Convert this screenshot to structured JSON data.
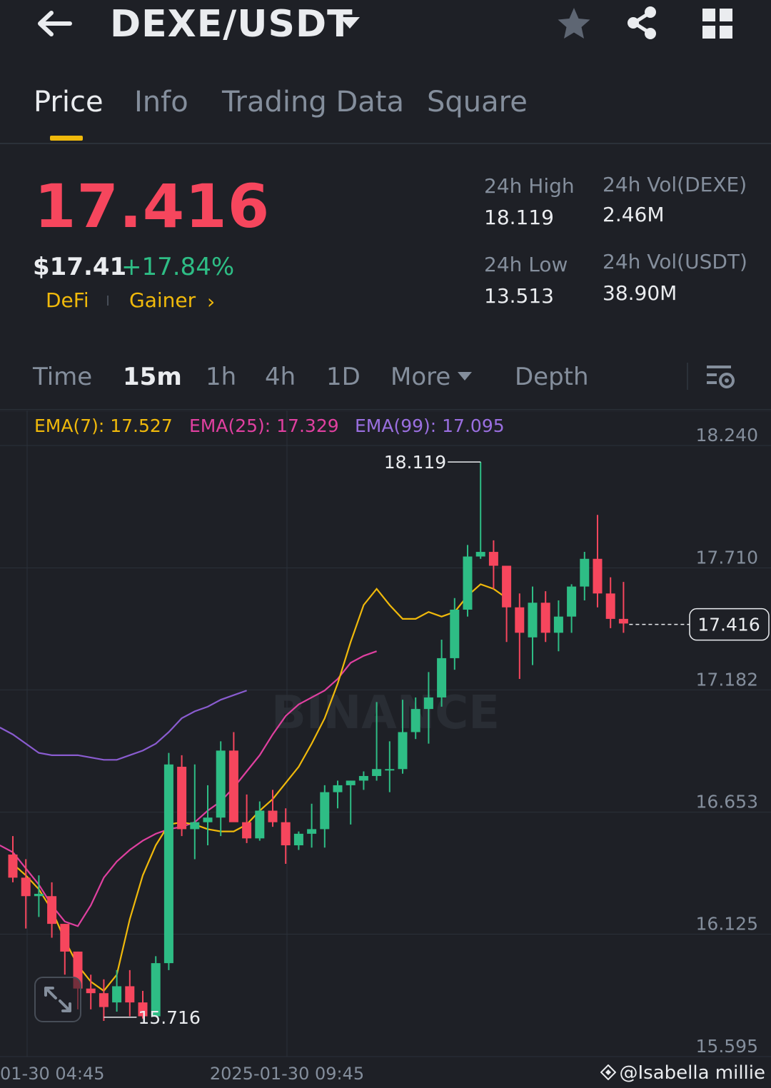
{
  "header": {
    "pair": "DEXE/USDT"
  },
  "tabs": [
    {
      "label": "Price",
      "active": true
    },
    {
      "label": "Info",
      "active": false
    },
    {
      "label": "Trading Data",
      "active": false
    },
    {
      "label": "Square",
      "active": false
    }
  ],
  "ticker": {
    "last_price": "17.416",
    "usd_price": "$17.41",
    "change_pct": "+17.84%",
    "tags": [
      "DeFi",
      "Gainer"
    ],
    "high_24h_label": "24h High",
    "high_24h": "18.119",
    "low_24h_label": "24h Low",
    "low_24h": "13.513",
    "vol_base_label": "24h Vol(DEXE)",
    "vol_base": "2.46M",
    "vol_quote_label": "24h Vol(USDT)",
    "vol_quote": "38.90M"
  },
  "intervals": {
    "items": [
      "Time",
      "15m",
      "1h",
      "4h",
      "1D",
      "More",
      "Depth"
    ],
    "active": "15m"
  },
  "indicators": {
    "ema7": "EMA(7): 17.527",
    "ema25": "EMA(25): 17.329",
    "ema99": "EMA(99): 17.095"
  },
  "colors": {
    "up": "#2ebd85",
    "down": "#f6465d",
    "accent": "#f0b90b",
    "ema7": "#f0b90b",
    "ema25": "#e040a0",
    "ema99": "#8a5cd0"
  },
  "chart_data": {
    "type": "candlestick",
    "y_ticks": [
      "18.240",
      "17.710",
      "17.182",
      "16.653",
      "16.125",
      "15.595"
    ],
    "x_ticks": [
      "01-30 04:45",
      "2025-01-30 09:45"
    ],
    "current_price_label": "17.416",
    "high_marker": "18.119",
    "low_marker": "15.716",
    "ylim": [
      15.595,
      18.24
    ],
    "candles": [
      {
        "o": 16.42,
        "h": 16.5,
        "l": 16.3,
        "c": 16.32
      },
      {
        "o": 16.32,
        "h": 16.4,
        "l": 16.1,
        "c": 16.24
      },
      {
        "o": 16.24,
        "h": 16.33,
        "l": 16.15,
        "c": 16.25
      },
      {
        "o": 16.24,
        "h": 16.3,
        "l": 16.06,
        "c": 16.12
      },
      {
        "o": 16.12,
        "h": 16.12,
        "l": 15.9,
        "c": 16.0
      },
      {
        "o": 16.0,
        "h": 16.0,
        "l": 15.75,
        "c": 15.84
      },
      {
        "o": 15.84,
        "h": 15.9,
        "l": 15.75,
        "c": 15.82
      },
      {
        "o": 15.82,
        "h": 15.88,
        "l": 15.7,
        "c": 15.76
      },
      {
        "o": 15.78,
        "h": 15.92,
        "l": 15.74,
        "c": 15.85
      },
      {
        "o": 15.85,
        "h": 15.92,
        "l": 15.72,
        "c": 15.78
      },
      {
        "o": 15.78,
        "h": 15.83,
        "l": 15.71,
        "c": 15.72
      },
      {
        "o": 15.72,
        "h": 15.98,
        "l": 15.72,
        "c": 15.95
      },
      {
        "o": 15.95,
        "h": 16.86,
        "l": 15.92,
        "c": 16.81
      },
      {
        "o": 16.8,
        "h": 16.85,
        "l": 16.5,
        "c": 16.53
      },
      {
        "o": 16.53,
        "h": 16.81,
        "l": 16.4,
        "c": 16.56
      },
      {
        "o": 16.56,
        "h": 16.72,
        "l": 16.46,
        "c": 16.58
      },
      {
        "o": 16.58,
        "h": 16.91,
        "l": 16.5,
        "c": 16.87
      },
      {
        "o": 16.87,
        "h": 16.95,
        "l": 16.6,
        "c": 16.56
      },
      {
        "o": 16.56,
        "h": 16.68,
        "l": 16.47,
        "c": 16.49
      },
      {
        "o": 16.49,
        "h": 16.65,
        "l": 16.48,
        "c": 16.61
      },
      {
        "o": 16.61,
        "h": 16.7,
        "l": 16.54,
        "c": 16.56
      },
      {
        "o": 16.56,
        "h": 16.62,
        "l": 16.38,
        "c": 16.46
      },
      {
        "o": 16.46,
        "h": 16.52,
        "l": 16.44,
        "c": 16.51
      },
      {
        "o": 16.51,
        "h": 16.64,
        "l": 16.45,
        "c": 16.53
      },
      {
        "o": 16.53,
        "h": 16.72,
        "l": 16.45,
        "c": 16.69
      },
      {
        "o": 16.69,
        "h": 16.74,
        "l": 16.62,
        "c": 16.72
      },
      {
        "o": 16.72,
        "h": 16.74,
        "l": 16.55,
        "c": 16.74
      },
      {
        "o": 16.74,
        "h": 16.78,
        "l": 16.7,
        "c": 16.76
      },
      {
        "o": 16.76,
        "h": 17.08,
        "l": 16.74,
        "c": 16.79
      },
      {
        "o": 16.79,
        "h": 16.91,
        "l": 16.69,
        "c": 16.79
      },
      {
        "o": 16.79,
        "h": 17.09,
        "l": 16.77,
        "c": 16.95
      },
      {
        "o": 16.95,
        "h": 17.1,
        "l": 16.92,
        "c": 17.05
      },
      {
        "o": 17.05,
        "h": 17.21,
        "l": 16.9,
        "c": 17.1
      },
      {
        "o": 17.1,
        "h": 17.35,
        "l": 17.06,
        "c": 17.27
      },
      {
        "o": 17.27,
        "h": 17.53,
        "l": 17.22,
        "c": 17.48
      },
      {
        "o": 17.48,
        "h": 17.76,
        "l": 17.45,
        "c": 17.71
      },
      {
        "o": 17.71,
        "h": 18.12,
        "l": 17.7,
        "c": 17.73
      },
      {
        "o": 17.73,
        "h": 17.78,
        "l": 17.57,
        "c": 17.67
      },
      {
        "o": 17.67,
        "h": 17.66,
        "l": 17.34,
        "c": 17.49
      },
      {
        "o": 17.49,
        "h": 17.55,
        "l": 17.18,
        "c": 17.38
      },
      {
        "o": 17.36,
        "h": 17.58,
        "l": 17.24,
        "c": 17.51
      },
      {
        "o": 17.51,
        "h": 17.56,
        "l": 17.34,
        "c": 17.38
      },
      {
        "o": 17.38,
        "h": 17.52,
        "l": 17.3,
        "c": 17.45
      },
      {
        "o": 17.45,
        "h": 17.59,
        "l": 17.38,
        "c": 17.58
      },
      {
        "o": 17.58,
        "h": 17.73,
        "l": 17.52,
        "c": 17.7
      },
      {
        "o": 17.7,
        "h": 17.89,
        "l": 17.49,
        "c": 17.55
      },
      {
        "o": 17.55,
        "h": 17.62,
        "l": 17.4,
        "c": 17.44
      },
      {
        "o": 17.44,
        "h": 17.6,
        "l": 17.38,
        "c": 17.42
      }
    ],
    "ema7": [
      16.38,
      16.33,
      16.27,
      16.18,
      16.05,
      15.94,
      15.87,
      15.83,
      15.9,
      16.14,
      16.33,
      16.46,
      16.55,
      16.56,
      16.55,
      16.53,
      16.52,
      16.52,
      16.55,
      16.61,
      16.66,
      16.73,
      16.8,
      16.9,
      17.01,
      17.16,
      17.34,
      17.5,
      17.57,
      17.5,
      17.44,
      17.44,
      17.47,
      17.45,
      17.47,
      17.54,
      17.59,
      17.57,
      17.53
    ],
    "ema25": [
      16.46,
      16.43,
      16.36,
      16.29,
      16.2,
      16.13,
      16.11,
      16.2,
      16.32,
      16.39,
      16.44,
      16.48,
      16.51,
      16.53,
      16.54,
      16.56,
      16.61,
      16.65,
      16.71,
      16.78,
      16.85,
      16.94,
      17.02,
      17.07,
      17.1,
      17.13,
      17.18,
      17.25,
      17.28,
      17.3
    ],
    "ema99": [
      16.97,
      16.94,
      16.9,
      16.86,
      16.85,
      16.85,
      16.85,
      16.84,
      16.83,
      16.83,
      16.85,
      16.87,
      16.9,
      16.95,
      17.01,
      17.04,
      17.06,
      17.09,
      17.11,
      17.13
    ]
  },
  "credit": "@Isabella millie"
}
